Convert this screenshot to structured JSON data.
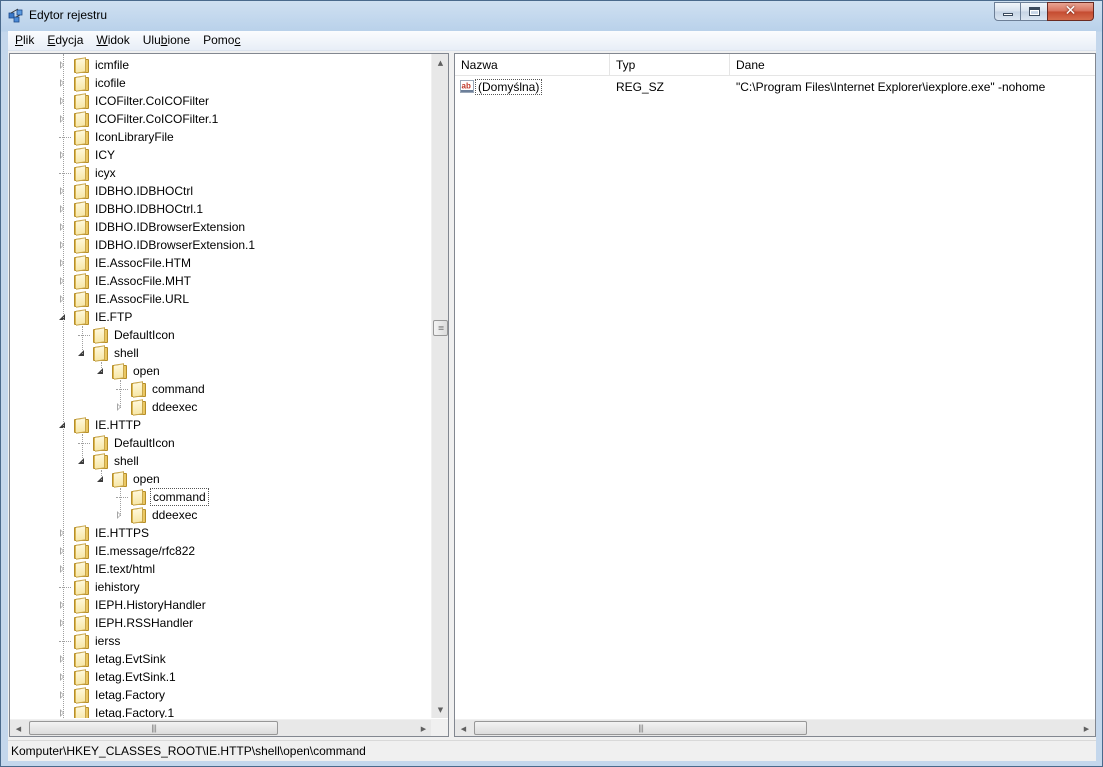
{
  "window": {
    "title": "Edytor rejestru"
  },
  "menu": [
    {
      "pre": "",
      "u": "P",
      "post": "lik"
    },
    {
      "pre": "",
      "u": "E",
      "post": "dycja"
    },
    {
      "pre": "",
      "u": "W",
      "post": "idok"
    },
    {
      "pre": "Ulu",
      "u": "b",
      "post": "ione"
    },
    {
      "pre": "Pomo",
      "u": "c",
      "post": ""
    }
  ],
  "tree": [
    {
      "label": "icmfile",
      "depth": 0,
      "state": "closed"
    },
    {
      "label": "icofile",
      "depth": 0,
      "state": "closed"
    },
    {
      "label": "ICOFilter.CoICOFilter",
      "depth": 0,
      "state": "closed"
    },
    {
      "label": "ICOFilter.CoICOFilter.1",
      "depth": 0,
      "state": "closed"
    },
    {
      "label": "IconLibraryFile",
      "depth": 0,
      "state": "leaf"
    },
    {
      "label": "ICY",
      "depth": 0,
      "state": "closed"
    },
    {
      "label": "icyx",
      "depth": 0,
      "state": "leaf"
    },
    {
      "label": "IDBHO.IDBHOCtrl",
      "depth": 0,
      "state": "closed"
    },
    {
      "label": "IDBHO.IDBHOCtrl.1",
      "depth": 0,
      "state": "closed"
    },
    {
      "label": "IDBHO.IDBrowserExtension",
      "depth": 0,
      "state": "closed"
    },
    {
      "label": "IDBHO.IDBrowserExtension.1",
      "depth": 0,
      "state": "closed"
    },
    {
      "label": "IE.AssocFile.HTM",
      "depth": 0,
      "state": "closed"
    },
    {
      "label": "IE.AssocFile.MHT",
      "depth": 0,
      "state": "closed"
    },
    {
      "label": "IE.AssocFile.URL",
      "depth": 0,
      "state": "closed"
    },
    {
      "label": "IE.FTP",
      "depth": 0,
      "state": "open"
    },
    {
      "label": "DefaultIcon",
      "depth": 1,
      "state": "leaf"
    },
    {
      "label": "shell",
      "depth": 1,
      "state": "open"
    },
    {
      "label": "open",
      "depth": 2,
      "state": "open"
    },
    {
      "label": "command",
      "depth": 3,
      "state": "leaf"
    },
    {
      "label": "ddeexec",
      "depth": 3,
      "state": "closed"
    },
    {
      "label": "IE.HTTP",
      "depth": 0,
      "state": "open"
    },
    {
      "label": "DefaultIcon",
      "depth": 1,
      "state": "leaf"
    },
    {
      "label": "shell",
      "depth": 1,
      "state": "open"
    },
    {
      "label": "open",
      "depth": 2,
      "state": "open"
    },
    {
      "label": "command",
      "depth": 3,
      "state": "leaf",
      "selected": true
    },
    {
      "label": "ddeexec",
      "depth": 3,
      "state": "closed"
    },
    {
      "label": "IE.HTTPS",
      "depth": 0,
      "state": "closed"
    },
    {
      "label": "IE.message/rfc822",
      "depth": 0,
      "state": "closed"
    },
    {
      "label": "IE.text/html",
      "depth": 0,
      "state": "closed"
    },
    {
      "label": "iehistory",
      "depth": 0,
      "state": "leaf"
    },
    {
      "label": "IEPH.HistoryHandler",
      "depth": 0,
      "state": "closed"
    },
    {
      "label": "IEPH.RSSHandler",
      "depth": 0,
      "state": "closed"
    },
    {
      "label": "ierss",
      "depth": 0,
      "state": "leaf"
    },
    {
      "label": "Ietag.EvtSink",
      "depth": 0,
      "state": "closed"
    },
    {
      "label": "Ietag.EvtSink.1",
      "depth": 0,
      "state": "closed"
    },
    {
      "label": "Ietag.Factory",
      "depth": 0,
      "state": "closed"
    },
    {
      "label": "Ietag.Factory.1",
      "depth": 0,
      "state": "closed"
    }
  ],
  "list": {
    "columns": {
      "name": "Nazwa",
      "type": "Typ",
      "data": "Dane"
    },
    "rows": [
      {
        "name": "(Domyślna)",
        "type": "REG_SZ",
        "data": "\"C:\\Program Files\\Internet Explorer\\iexplore.exe\" -nohome",
        "icon": "string-value-icon"
      }
    ]
  },
  "status": {
    "path": "Komputer\\HKEY_CLASSES_ROOT\\IE.HTTP\\shell\\open\\command"
  }
}
